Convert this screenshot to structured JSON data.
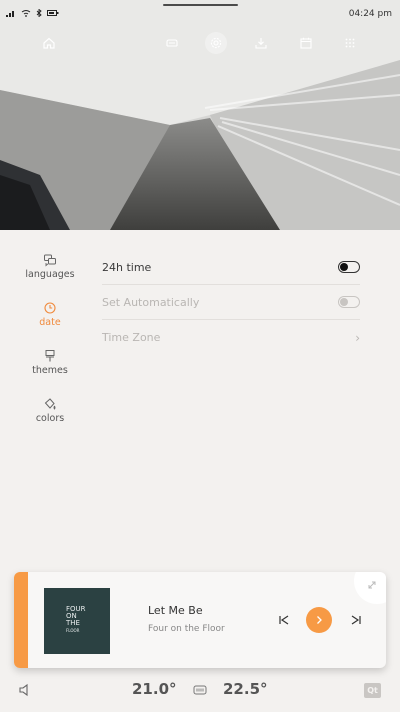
{
  "status": {
    "time": "04:24 pm"
  },
  "nav": {
    "icons": [
      "home-icon",
      "car-seat-icon",
      "settings-icon",
      "download-icon",
      "calendar-icon",
      "apps-grid-icon"
    ]
  },
  "sidebar": {
    "items": [
      {
        "label": "languages",
        "icon": "languages-icon"
      },
      {
        "label": "date",
        "icon": "clock-icon",
        "active": true
      },
      {
        "label": "themes",
        "icon": "brush-icon"
      },
      {
        "label": "colors",
        "icon": "palette-icon"
      }
    ]
  },
  "settings": {
    "rows": [
      {
        "label": "24h time",
        "control": "toggle",
        "state": "on-dark"
      },
      {
        "label": "Set Automatically",
        "control": "toggle",
        "state": "disabled"
      },
      {
        "label": "Time Zone",
        "control": "chevron"
      }
    ],
    "chevron": "›"
  },
  "player": {
    "title": "Let Me Be",
    "artist": "Four on the Floor",
    "album_art_text": [
      "FOUR",
      "ON",
      "THE",
      "FLOOR"
    ],
    "accent": "#f79a45"
  },
  "climate": {
    "left_temp": "21.0°",
    "right_temp": "22.5°"
  },
  "brand": {
    "qt_label": "Qt"
  }
}
